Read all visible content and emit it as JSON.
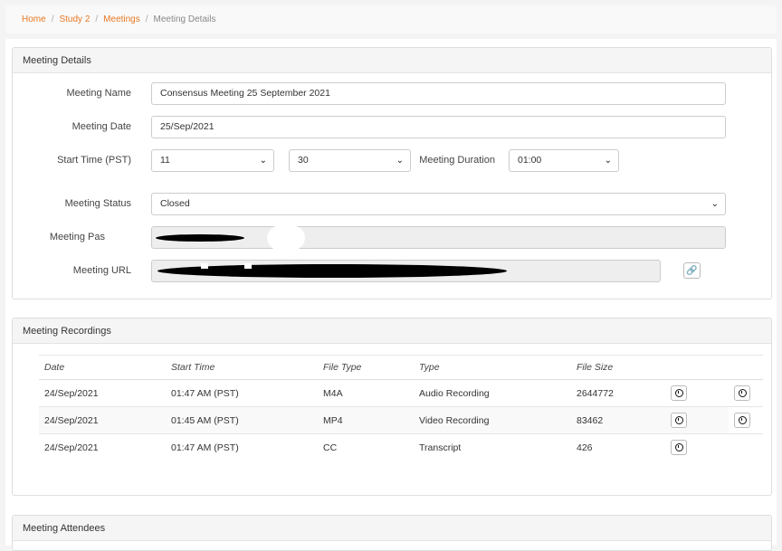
{
  "breadcrumb": {
    "items": [
      "Home",
      "Study 2",
      "Meetings"
    ],
    "current": "Meeting Details"
  },
  "details": {
    "heading": "Meeting Details",
    "name_label": "Meeting Name",
    "name_value": "Consensus Meeting 25 September 2021",
    "date_label": "Meeting Date",
    "date_value": "25/Sep/2021",
    "start_label": "Start Time (PST)",
    "start_hour": "11",
    "start_minute": "30",
    "duration_label": "Meeting Duration",
    "duration_value": "01:00",
    "status_label": "Meeting Status",
    "status_value": "Closed",
    "pass_label": "Meeting Pas",
    "url_label": "Meeting URL",
    "link_icon": "link-icon"
  },
  "recordings": {
    "heading": "Meeting Recordings",
    "columns": [
      "Date",
      "Start Time",
      "File Type",
      "Type",
      "File Size"
    ],
    "rows": [
      {
        "date": "24/Sep/2021",
        "start": "01:47 AM (PST)",
        "filetype": "M4A",
        "type": "Audio Recording",
        "size": "2644772"
      },
      {
        "date": "24/Sep/2021",
        "start": "01:45 AM (PST)",
        "filetype": "MP4",
        "type": "Video Recording",
        "size": "83462"
      },
      {
        "date": "24/Sep/2021",
        "start": "01:47 AM (PST)",
        "filetype": "CC",
        "type": "Transcript",
        "size": "426"
      }
    ]
  },
  "attendees": {
    "heading": "Meeting Attendees"
  },
  "colors": {
    "accent": "#e87722",
    "panel_heading_bg": "#f5f5f5",
    "disabled_field_bg": "#eeeeee",
    "redaction": "#000000"
  }
}
